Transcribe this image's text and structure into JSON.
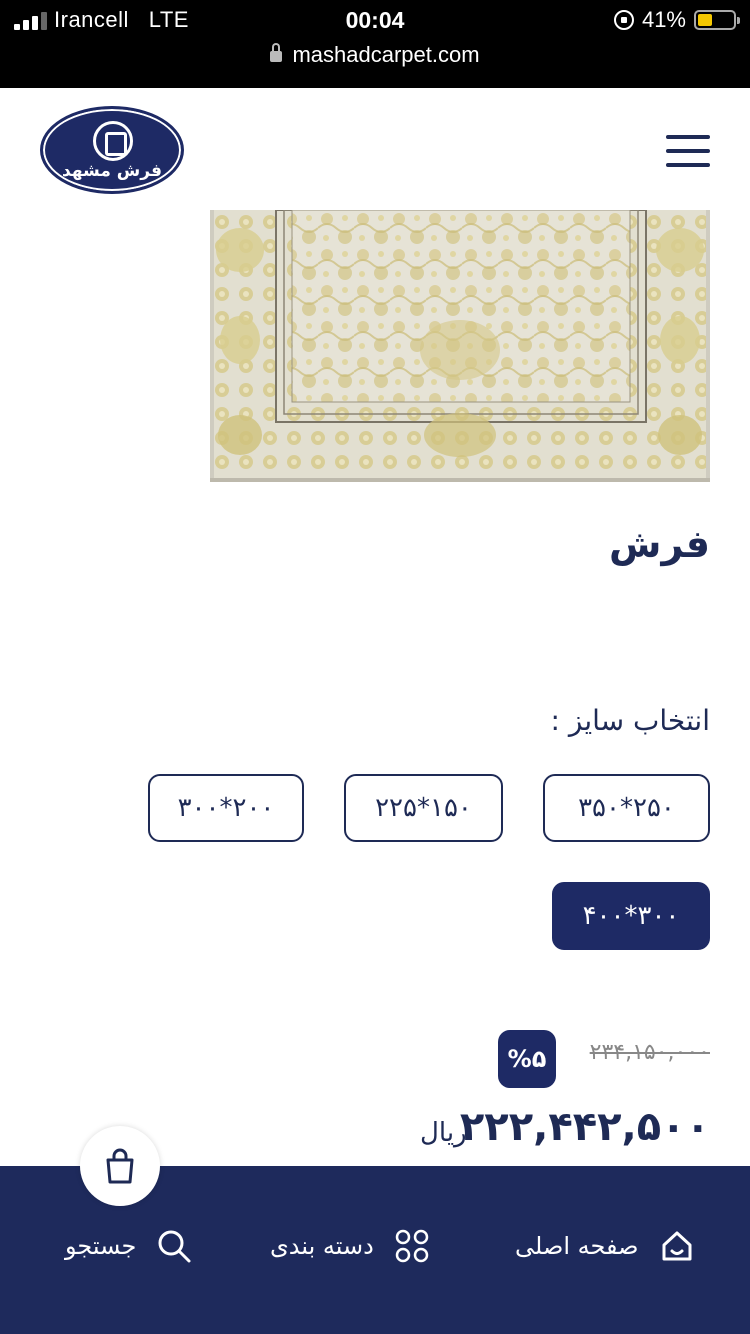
{
  "status_bar": {
    "carrier": "Irancell",
    "network": "LTE",
    "time": "00:04",
    "battery": "41%",
    "url": "mashadcarpet.com"
  },
  "header": {
    "logo_text": "فرش مشهد",
    "menu_icon": "hamburger-menu-icon"
  },
  "product": {
    "title": "فرش",
    "size_label": "انتخاب سایز :",
    "sizes": [
      "۳۵۰*۲۵۰",
      "۲۲۵*۱۵۰",
      "۳۰۰*۲۰۰",
      "۴۰۰*۳۰۰"
    ],
    "selected_size": "۴۰۰*۳۰۰",
    "old_price": "۲۳۴,۱۵۰,۰۰۰",
    "discount": "%۵",
    "price": "۲۲۲,۴۴۲,۵۰۰",
    "currency": "ریال"
  },
  "bottom_nav": {
    "home": "صفحه اصلی",
    "categories": "دسته بندی",
    "search": "جستجو",
    "cart_icon": "shopping-bag-icon"
  },
  "colors": {
    "brand_navy": "#1e2a5c",
    "carpet_gold": "#d4c98a"
  }
}
